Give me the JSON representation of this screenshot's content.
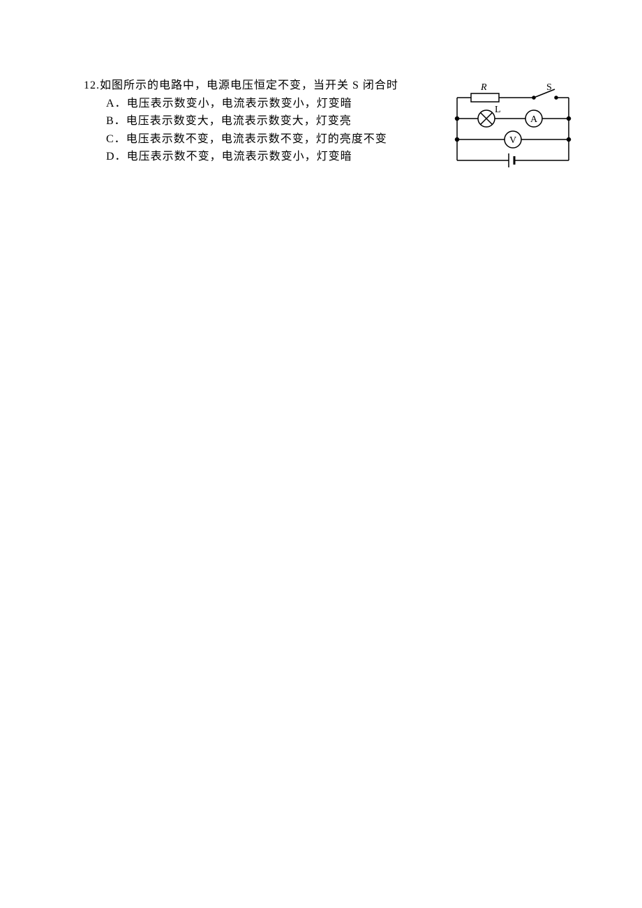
{
  "question": {
    "number": "12.",
    "stem": "如图所示的电路中，电源电压恒定不变，当开关 S 闭合时",
    "options": [
      {
        "label": "A．",
        "text": "电压表示数变小，电流表示数变小，灯变暗"
      },
      {
        "label": "B．",
        "text": "电压表示数变大，电流表示数变大，灯变亮"
      },
      {
        "label": "C．",
        "text": "电压表示数不变，电流表示数不变，灯的亮度不变"
      },
      {
        "label": "D．",
        "text": "电压表示数不变，电流表示数变小，灯变暗"
      }
    ]
  },
  "circuit": {
    "resistor_label": "R",
    "switch_label": "S",
    "lamp_label": "L",
    "ammeter_label": "A",
    "voltmeter_label": "V"
  }
}
